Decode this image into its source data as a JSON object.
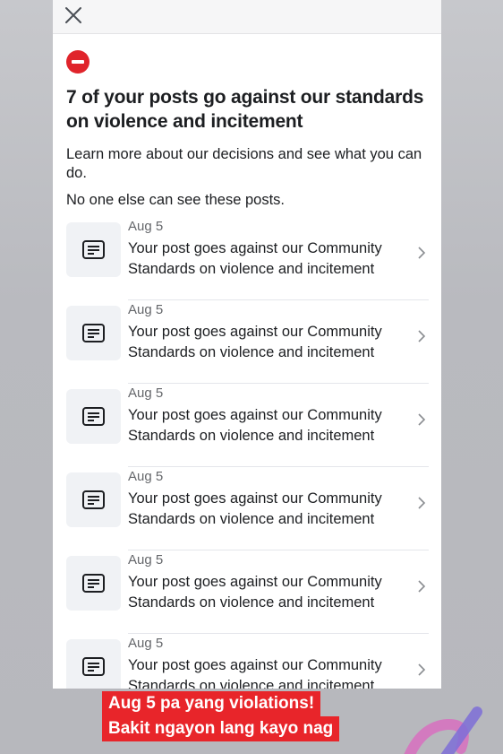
{
  "sheet": {
    "close_icon": "close-icon",
    "headline": "7 of your posts go against our standards on violence and incitement",
    "description": "Learn more about our decisions and see what you can do.",
    "note": "No one else can see these posts."
  },
  "posts": [
    {
      "date": "Aug 5",
      "text": "Your post goes against our Community Standards on violence and incitement"
    },
    {
      "date": "Aug 5",
      "text": "Your post goes against our Community Standards on violence and incitement"
    },
    {
      "date": "Aug 5",
      "text": "Your post goes against our Community Standards on violence and incitement"
    },
    {
      "date": "Aug 5",
      "text": "Your post goes against our Community Standards on violence and incitement"
    },
    {
      "date": "Aug 5",
      "text": "Your post goes against our Community Standards on violence and incitement"
    },
    {
      "date": "Aug 5",
      "text": "Your post goes against our Community Standards on violence and incitement"
    }
  ],
  "caption": {
    "line1": "Aug 5 pa yang violations!",
    "line2": "Bakit ngayon lang kayo nag"
  },
  "colors": {
    "stop": "#e0242b",
    "caption_bg": "#e8252a"
  }
}
